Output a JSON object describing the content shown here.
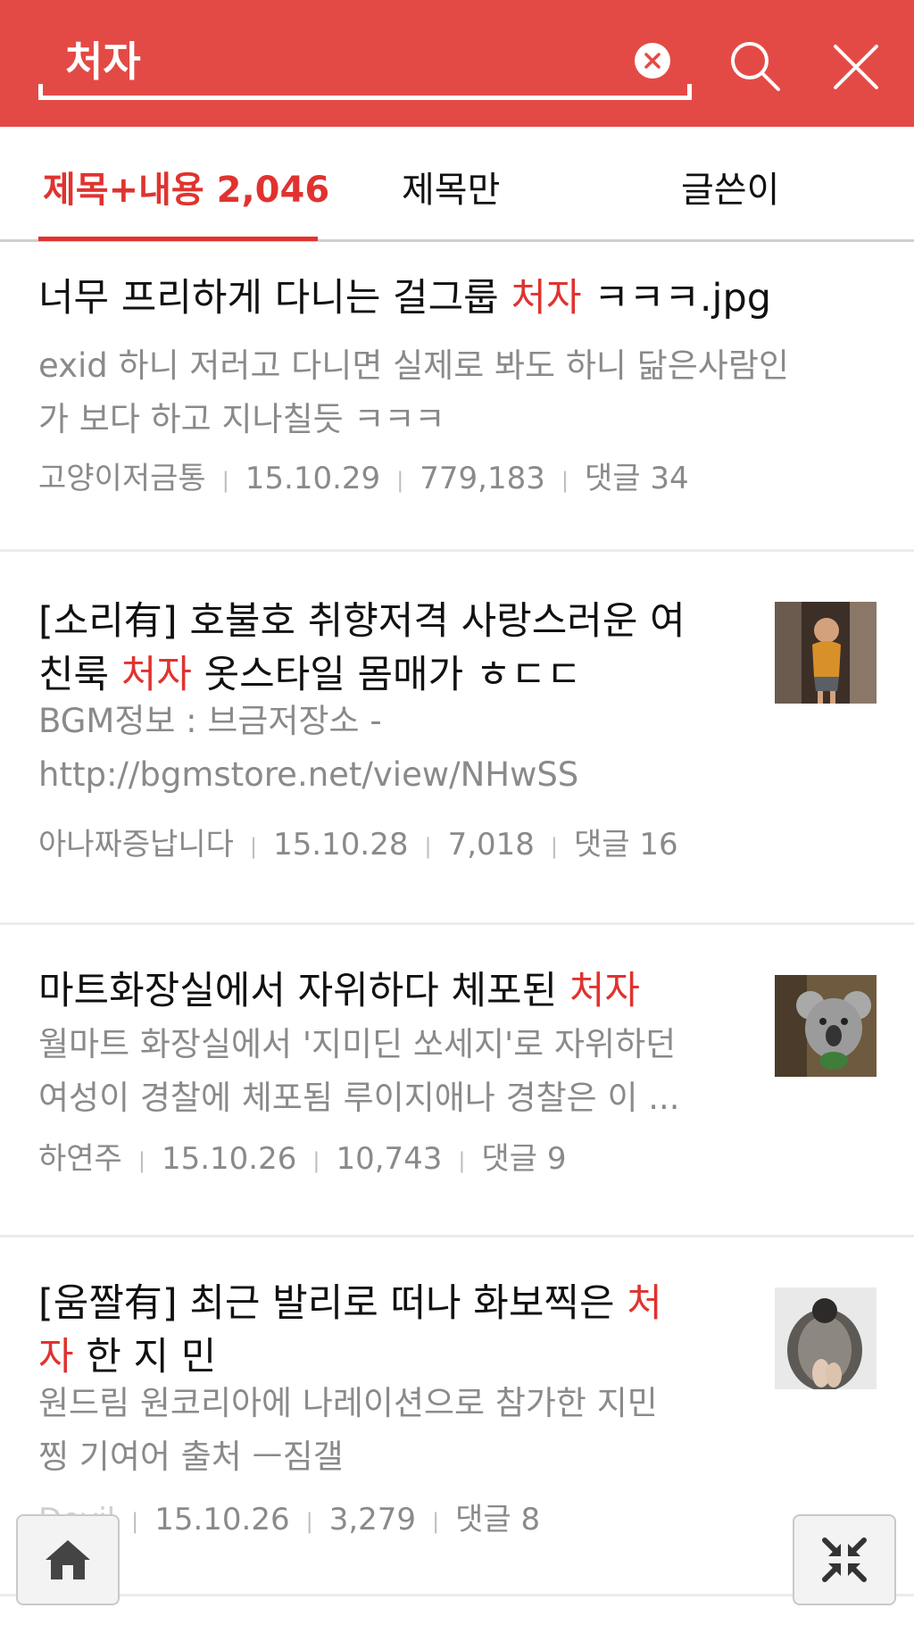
{
  "search": {
    "query": "처자"
  },
  "tabs": [
    {
      "label": "제목+내용 2,046"
    },
    {
      "label": "제목만"
    },
    {
      "label": "글쓴이"
    }
  ],
  "results": [
    {
      "title_before": "너무 프리하게 다니는 걸그룹 ",
      "title_highlight": "처자",
      "title_after": " ㅋㅋㅋ.jpg",
      "snippet_line1": "exid 하니 저러고 다니면 실제로 봐도 하니 닮은사람인",
      "snippet_line2": "가 보다 하고 지나칠듯 ㅋㅋㅋ",
      "author": "고양이저금통",
      "date": "15.10.29",
      "views": "779,183",
      "comments": "댓글 34"
    },
    {
      "title_line1": "[소리有] 호불호 취향저격 사랑스러운 여",
      "title_line2_before": "친룩 ",
      "title_highlight": "처자",
      "title_line2_after": " 옷스타일 몸매가 ㅎㄷㄷ",
      "snippet_line1": "BGM정보 : 브금저장소 -",
      "snippet_line2": "http://bgmstore.net/view/NHwSS",
      "author": "아나짜증납니다",
      "date": "15.10.28",
      "views": "7,018",
      "comments": "댓글 16"
    },
    {
      "title_before": "마트화장실에서 자위하다 체포된 ",
      "title_highlight": "처자",
      "snippet_line1": "월마트 화장실에서 '지미딘 쏘세지'로 자위하던",
      "snippet_line2": "여성이 경찰에 체포됨 루이지애나 경찰은 이 ...",
      "author": "하연주",
      "date": "15.10.26",
      "views": "10,743",
      "comments": "댓글 9"
    },
    {
      "title_line1_before": "[움짤有] 최근 발리로 떠나 화보찍은 ",
      "title_highlight_1": "처",
      "title_highlight_2": "자",
      "title_line2_after": " 한 지 민",
      "snippet_line1": "원드림 원코리아에 나레이션으로 참가한 지민",
      "snippet_line2": "찡 기여어 출처 ㅡ짐갤",
      "author": "Devil",
      "date": "15.10.26",
      "views": "3,279",
      "comments": "댓글 8"
    }
  ],
  "icons": {
    "clear": "clear-icon",
    "search": "search-icon",
    "close": "close-icon",
    "home": "home-icon",
    "collapse": "collapse-icon"
  },
  "colors": {
    "header": "#e44a45",
    "accent": "#e0332f",
    "muted": "#8a8a8a"
  }
}
